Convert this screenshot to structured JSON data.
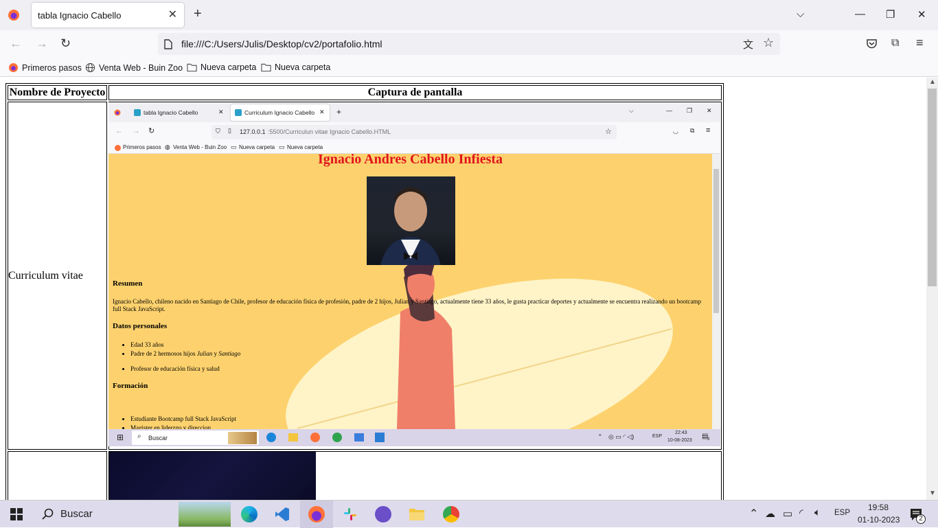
{
  "browser": {
    "tab_title": "tabla Ignacio Cabello",
    "url": "file:///C:/Users/Julis/Desktop/cv2/portafolio.html",
    "bookmarks": [
      "Primeros pasos",
      "Venta Web - Buin Zoo",
      "Nueva carpeta",
      "Nueva carpeta"
    ]
  },
  "table": {
    "header_project": "Nombre de Proyecto",
    "header_capture": "Captura de pantalla",
    "row1_name": "Curriculum vitae"
  },
  "shot": {
    "tab1": "tabla Ignacio Cabello",
    "tab2": "Curriculum Ignacio Cabello",
    "url_host": "127.0.0.1",
    "url_rest": ":5500/Curriculun vitae Ignacio Cabello.HTML",
    "bookmarks": [
      "Primeros pasos",
      "Venta Web - Buin Zoo",
      "Nueva carpeta",
      "Nueva carpeta"
    ],
    "name": "Ignacio Andres Cabello Infiesta",
    "resumen_title": "Resumen",
    "resumen_text": "Ignacio Cabello, chileno nacido en Santiago de Chile, profesor de educación física de profesión, padre de 2 hijos, Julian y Santiago, actualmente tiene 33 años, le gusta practicar deportes y actualmente se encuentra realizando un bootcamp full Stack JavaScript.",
    "datos_title": "Datos personales",
    "datos_1": "Edad 33 años",
    "datos_2_pre": "Padre de 2 hermosos hijos ",
    "datos_2_a": "Julian",
    "datos_2_mid": " y ",
    "datos_2_b": "Santiago",
    "datos_3": "Profesor de educación física y salud",
    "formacion_title": "Formación",
    "formacion_1": "Estudiante Bootcamp full Stack JavaScript",
    "formacion_2": "Magister en liderzgo y direccion",
    "task_search": "Buscar",
    "task_lang": "ESP",
    "task_time": "22:43",
    "task_date": "10-08-2023",
    "task_notif": "3"
  },
  "taskbar": {
    "search": "Buscar",
    "lang": "ESP",
    "time": "19:58",
    "date": "01-10-2023",
    "notif": "2"
  },
  "colors": {
    "cv_background": "#fdd26e",
    "cv_title": "#e0141b"
  }
}
